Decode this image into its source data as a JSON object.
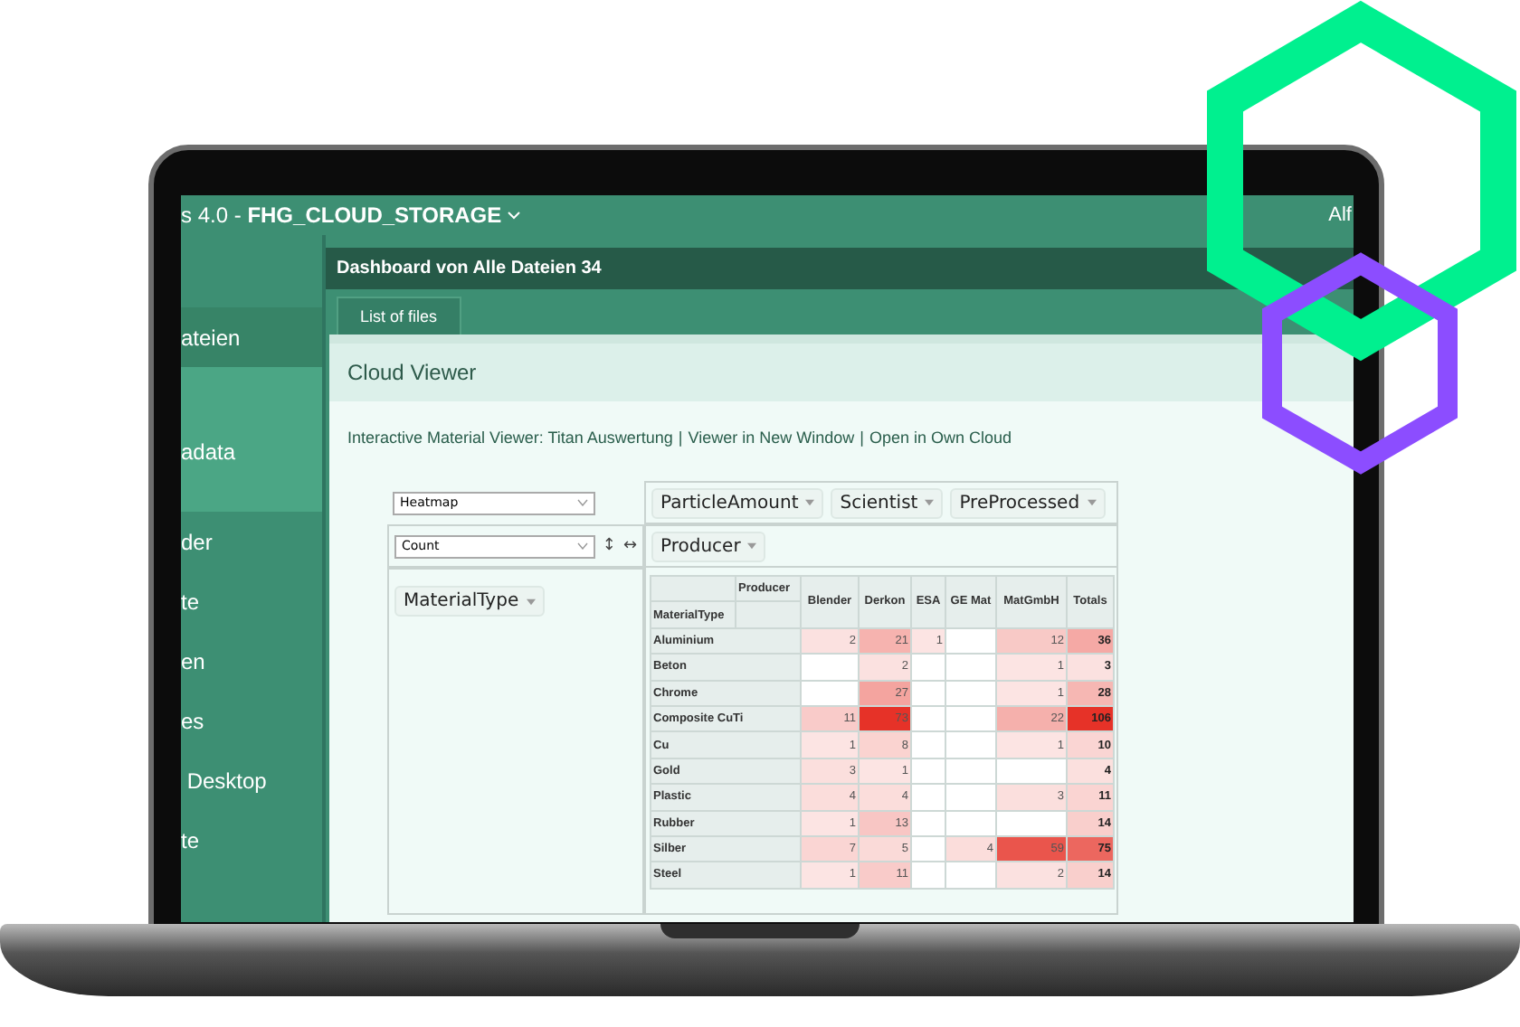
{
  "app_bar": {
    "title_prefix": "s 4.0 - ",
    "title": "FHG_CLOUD_STORAGE",
    "user": "Alf"
  },
  "sidebar": {
    "items": [
      {
        "label": "ateien",
        "selected": false
      },
      {
        "label": "adata",
        "selected": true
      },
      {
        "label": "der",
        "selected": false
      },
      {
        "label": "te",
        "selected": false
      },
      {
        "label": "en",
        "selected": false
      },
      {
        "label": "es",
        "selected": false
      },
      {
        "label": " Desktop",
        "selected": false
      },
      {
        "label": "te",
        "selected": false
      }
    ]
  },
  "dashboard_title": "Dashboard von Alle Dateien 34",
  "tabs": [
    {
      "label": "List of files",
      "selected": true
    }
  ],
  "panel": {
    "title": "Cloud Viewer",
    "separator": "|",
    "links": [
      "Interactive Material Viewer: Titan Auswertung",
      "Viewer in New Window",
      "Open in Own Cloud"
    ]
  },
  "pivot": {
    "renderer": "Heatmap",
    "aggregator": "Count",
    "row_order": "↕",
    "col_order": "↔",
    "unused_attributes": [
      "ParticleAmount",
      "Scientist",
      "PreProcessed"
    ],
    "col_attributes": [
      "Producer"
    ],
    "row_attributes": [
      "MaterialType"
    ],
    "table": {
      "col_attr_label": "Producer",
      "row_attr_label": "MaterialType",
      "columns": [
        "Blender",
        "Derkon",
        "ESA",
        "GE Mat",
        "MatGmbH",
        "Totals"
      ],
      "rows": [
        {
          "label": "Aluminium",
          "cells": [
            "2",
            "21",
            "1",
            "",
            "12",
            "36"
          ]
        },
        {
          "label": "Beton",
          "cells": [
            "",
            "2",
            "",
            "",
            "1",
            "3"
          ]
        },
        {
          "label": "Chrome",
          "cells": [
            "",
            "27",
            "",
            "",
            "1",
            "28"
          ]
        },
        {
          "label": "Composite CuTi",
          "cells": [
            "11",
            "73",
            "",
            "",
            "22",
            "106"
          ]
        },
        {
          "label": "Cu",
          "cells": [
            "1",
            "8",
            "",
            "",
            "1",
            "10"
          ]
        },
        {
          "label": "Gold",
          "cells": [
            "3",
            "1",
            "",
            "",
            "",
            "4"
          ]
        },
        {
          "label": "Plastic",
          "cells": [
            "4",
            "4",
            "",
            "",
            "3",
            "11"
          ]
        },
        {
          "label": "Rubber",
          "cells": [
            "1",
            "13",
            "",
            "",
            "",
            "14"
          ]
        },
        {
          "label": "Silber",
          "cells": [
            "7",
            "5",
            "",
            "4",
            "59",
            "75"
          ]
        },
        {
          "label": "Steel",
          "cells": [
            "1",
            "11",
            "",
            "",
            "2",
            "14"
          ]
        }
      ]
    }
  }
}
